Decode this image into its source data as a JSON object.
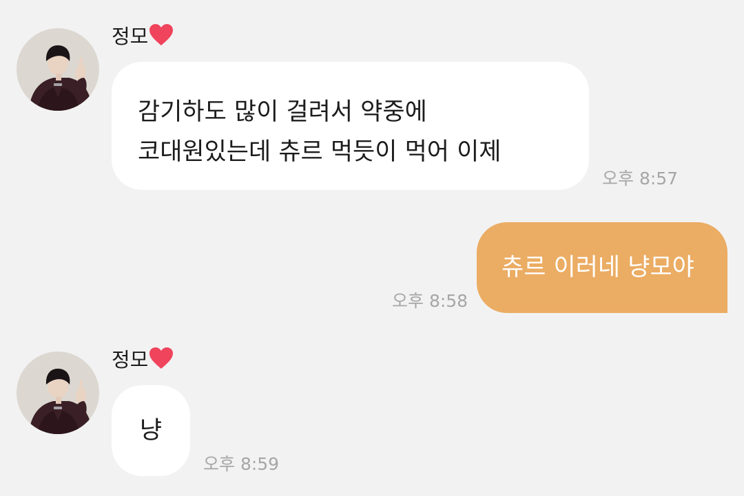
{
  "messages": [
    {
      "direction": "incoming",
      "sender": "정모",
      "lines": [
        "감기하도 많이 걸려서 약중에",
        "코대원있는데 츄르 먹듯이 먹어 이제"
      ],
      "time": "오후 8:57"
    },
    {
      "direction": "outgoing",
      "lines": [
        "츄르 이러네 냥모야"
      ],
      "time": "오후 8:58"
    },
    {
      "direction": "incoming",
      "sender": "정모",
      "lines": [
        "냥"
      ],
      "time": "오후 8:59"
    }
  ],
  "icons": {
    "sender_heart": "heart-icon",
    "avatar": "profile-photo"
  },
  "colors": {
    "background": "#f2f2f2",
    "incoming_bubble": "#ffffff",
    "outgoing_bubble": "#ebac63",
    "heart": "#f0445c",
    "timestamp": "#a6a6a6"
  }
}
